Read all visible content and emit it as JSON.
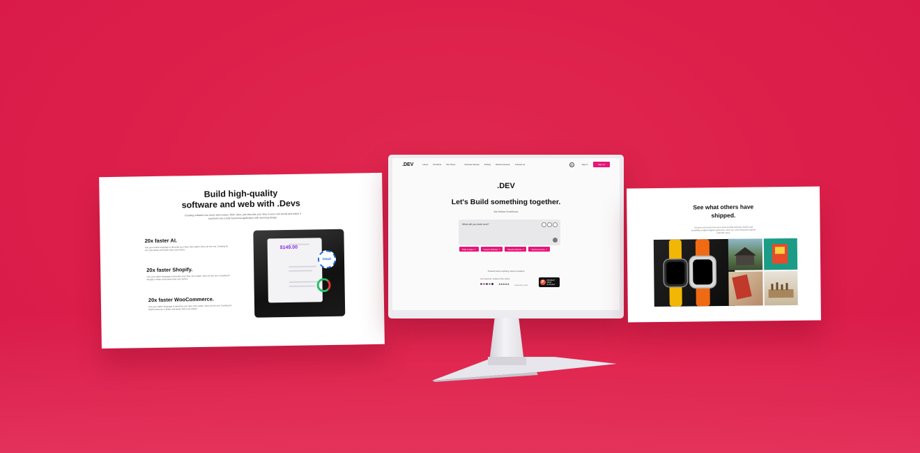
{
  "left_panel": {
    "title_line1": "Build high-quality",
    "title_line2": "software and web with .Devs",
    "description": "Creating software has never been easier. With .devs, just describe your idea in your own words and watch it transform into a fully functional application with stunning design.",
    "features": [
      {
        "title": "20x faster AI.",
        "text": "Use your native language to describe your idea, then watch .Devs do the rest. Creating for AI is 20x faster and easier than ever before."
      },
      {
        "title": "20x faster Shopify.",
        "text": "Use your native language to describe your idea, then watch .Devs do the rest. Creating for Shopify is faster and easier than ever before."
      },
      {
        "title": "20x faster WooCommerce.",
        "text": "Use your native language to describe your idea, then watch .Devs do the rest. Creating for WooCommerce is faster and easier than ever before."
      }
    ],
    "card": {
      "price": "$149.00",
      "badge": "intuit"
    }
  },
  "center_screen": {
    "nav": {
      "logo": ".DEV",
      "links": [
        "Home",
        "Products",
        "Our Team",
        "Success Stories",
        "Pricing",
        "WooCommerce",
        "Contact us"
      ],
      "signin": "Sign in",
      "signup": "Sign up"
    },
    "logo": ".DEV",
    "headline": "Let's Build something together.",
    "subtitle": "We Deliver Excellence",
    "prompt_placeholder": "What will you build next?",
    "chips": [
      "Build AI Apps ↗",
      "Custom Website ↗",
      "Shopify Website ↗",
      "WooCommerce ↗"
    ],
    "trust_text": "Trusted Users anything, fast & excellent",
    "join_text": "Join loyal fans, builders & 5k+ others",
    "by_text": "powered by devs",
    "badge": {
      "letter": "P",
      "line1": "PRODUCT HUNT",
      "line2": "#1 Product"
    }
  },
  "right_panel": {
    "title_line1": "See what others have",
    "title_line2": "shipped.",
    "description": "Creators and teams have used .Devs to build stunning, modern and beautifully designed digital experiences. Here are a few showcase projects built with .Devs."
  }
}
